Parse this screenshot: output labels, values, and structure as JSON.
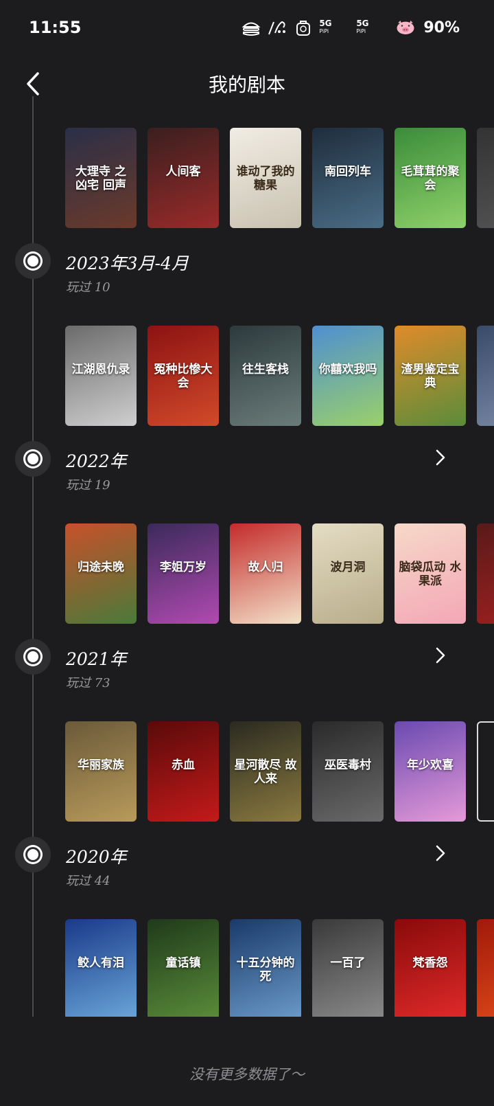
{
  "status_bar": {
    "time": "11:55",
    "network1": "5G",
    "network1_sub": "PiPi",
    "network2": "5G",
    "network2_sub": "PiPi",
    "battery": "90%",
    "icons": [
      "burger-icon",
      "signal-swirl-icon",
      "bag-icon",
      "network-5g-icon",
      "network-5g-icon",
      "pig-icon"
    ]
  },
  "header": {
    "title": "我的剧本",
    "back_icon": "chevron-left-icon"
  },
  "sections": [
    {
      "covers": [
        {
          "title": "大理寺 之 凶宅 回声",
          "colors": [
            "#2a2f48",
            "#6b3a2a"
          ]
        },
        {
          "title": "人间客",
          "colors": [
            "#3a1f1f",
            "#9b2a2a"
          ]
        },
        {
          "title": "谁动了我的糖果",
          "colors": [
            "#f1ede4",
            "#c9c1b0"
          ]
        },
        {
          "title": "南回列车",
          "colors": [
            "#1f2d3d",
            "#4a6d86"
          ]
        },
        {
          "title": "毛茸茸的聚会",
          "colors": [
            "#3a8c3a",
            "#8fd16a"
          ]
        },
        {
          "title": "",
          "colors": [
            "#333",
            "#555"
          ]
        }
      ]
    },
    {
      "year": "2023年3月-4月",
      "played": "玩过 10",
      "covers": [
        {
          "title": "江湖恩仇录",
          "colors": [
            "#6b6b6b",
            "#cfcfcf"
          ]
        },
        {
          "title": "冤种比惨大会",
          "colors": [
            "#8c1212",
            "#d24a2a"
          ]
        },
        {
          "title": "往生客栈",
          "colors": [
            "#2d3a3d",
            "#6a7c7a"
          ]
        },
        {
          "title": "你囍欢我吗",
          "colors": [
            "#4e8fd1",
            "#9ad06a"
          ]
        },
        {
          "title": "渣男鉴定宝典",
          "colors": [
            "#e08b2a",
            "#5a8c3a"
          ]
        },
        {
          "title": "",
          "colors": [
            "#3a4a6a",
            "#7a8aa6"
          ]
        }
      ]
    },
    {
      "year": "2022年",
      "played": "玩过 19",
      "covers": [
        {
          "title": "归途未晚",
          "colors": [
            "#c8502a",
            "#4a7a3a"
          ]
        },
        {
          "title": "李姐万岁",
          "colors": [
            "#3a2a5a",
            "#b14ab1"
          ]
        },
        {
          "title": "故人归",
          "colors": [
            "#c42b2b",
            "#f3e1c8"
          ]
        },
        {
          "title": "波月洞",
          "colors": [
            "#e4dcc4",
            "#b8ad8a"
          ]
        },
        {
          "title": "脑袋瓜动 水果派",
          "colors": [
            "#f6d8c8",
            "#f3a7b6"
          ]
        },
        {
          "title": "",
          "colors": [
            "#5a1a1a",
            "#a02020"
          ]
        }
      ]
    },
    {
      "year": "2021年",
      "played": "玩过 73",
      "covers": [
        {
          "title": "华丽家族",
          "colors": [
            "#6b5a3a",
            "#b89a5a"
          ]
        },
        {
          "title": "赤血",
          "colors": [
            "#5a0a0a",
            "#c41a1a"
          ]
        },
        {
          "title": "星河散尽 故人来",
          "colors": [
            "#2a2a20",
            "#8a7a40"
          ]
        },
        {
          "title": "巫医毒村",
          "colors": [
            "#2a2a2a",
            "#6a6a6a"
          ]
        },
        {
          "title": "年少欢喜",
          "colors": [
            "#6a4ab1",
            "#e59ad8"
          ]
        },
        {
          "title": "",
          "colors": [
            "#1c1c1e",
            "#1c1c1e"
          ]
        }
      ]
    },
    {
      "year": "2020年",
      "played": "玩过 44",
      "covers": [
        {
          "title": "鲛人有泪",
          "colors": [
            "#1a3a8a",
            "#6aa6d8"
          ]
        },
        {
          "title": "童话镇",
          "colors": [
            "#1f3a1a",
            "#5a8c3a"
          ]
        },
        {
          "title": "十五分钟的死",
          "colors": [
            "#1a3a6a",
            "#6a9ac8"
          ]
        },
        {
          "title": "一百了",
          "colors": [
            "#3a3a3a",
            "#8a8a8a"
          ]
        },
        {
          "title": "梵香怨",
          "colors": [
            "#8a0a0a",
            "#e02a2a"
          ]
        },
        {
          "title": "",
          "colors": [
            "#a01a0a",
            "#e04a1a"
          ]
        }
      ]
    }
  ],
  "footer": "没有更多数据了～"
}
